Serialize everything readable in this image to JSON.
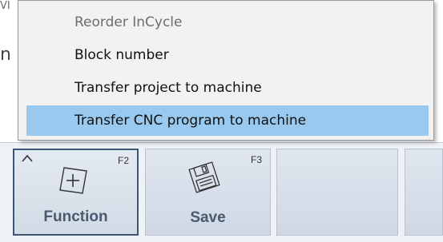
{
  "background": {
    "edge_text_top": "VI",
    "edge_text_mid": "n"
  },
  "menu": {
    "items": [
      {
        "label": "Reorder InCycle",
        "disabled": true
      },
      {
        "label": "Block number",
        "disabled": false
      },
      {
        "label": "Transfer project to machine",
        "disabled": false
      },
      {
        "label": "Transfer CNC program to machine",
        "disabled": false,
        "highlighted": true
      }
    ]
  },
  "function_bar": {
    "keys": [
      {
        "label": "Function",
        "key": "F2",
        "icon": "plus-square-icon",
        "active": true
      },
      {
        "label": "Save",
        "key": "F3",
        "icon": "floppy-disk-icon",
        "active": false
      },
      {
        "label": "",
        "key": "",
        "icon": "",
        "active": false
      },
      {
        "label": "",
        "key": "",
        "icon": "",
        "active": false
      }
    ]
  },
  "colors": {
    "menu_highlight": "#99c9ef",
    "active_key_border": "#3d5674"
  }
}
